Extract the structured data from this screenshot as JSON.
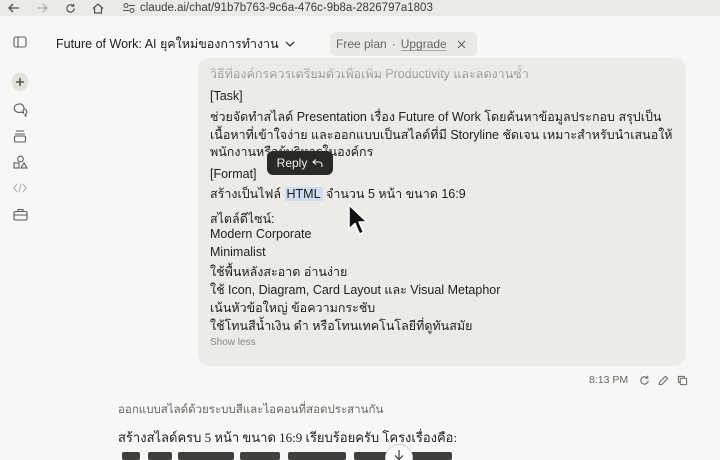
{
  "browser": {
    "url": "claude.ai/chat/91b7b763-9c6a-476c-9b8a-2826797a1803"
  },
  "header": {
    "chat_title": "Future of Work: AI ยุคใหม่ของการทำงาน",
    "plan_label": "Free plan",
    "plan_separator": "·",
    "upgrade_label": "Upgrade"
  },
  "user_message": {
    "lines": [
      "วิธีที่องค์กรควรเตรียมตัวเพื่อเพิ่ม Productivity และลดงานซ้ำ",
      "[Task]",
      "ช่วยจัดทำสไลด์ Presentation เรื่อง Future of Work โดยค้นหาข้อมูลประกอบ สรุปเป็น",
      "เนื้อหาที่เข้าใจง่าย และออกแบบเป็นสไลด์ที่มี Storyline ชัดเจน เหมาะสำหรับนำเสนอให้",
      "พนักงานหรือผู้บริหารในองค์กร",
      "[Format]",
      "สร้างเป็นไฟล์",
      "HTML",
      "จำนวน 5 หน้า ขนาด 16:9",
      "สไตล์ดีไซน์:",
      "Modern Corporate",
      "Minimalist",
      "ใช้พื้นหลังสะอาด อ่านง่าย",
      "ใช้ Icon, Diagram, Card Layout และ Visual Metaphor",
      "เน้นหัวข้อใหญ่ ข้อความกระชับ",
      "ใช้โทนสีน้ำเงิน ดำ หรือโทนเทคโนโลยีที่ดูทันสมัย"
    ],
    "show_less": "Show less"
  },
  "reply_tooltip": {
    "label": "Reply"
  },
  "message_actions": {
    "time": "8:13 PM"
  },
  "assistant_message": {
    "status": "ออกแบบสไลด์ด้วยระบบสีและไอคอนที่สอดประสานกัน",
    "reply_text": "สร้างสไลด์ครบ 5 หน้า ขนาด 16:9 เรียบร้อยครับ โครงเรื่องคือ:"
  },
  "icons": {
    "back": "arrow-left-icon",
    "forward": "arrow-right-icon",
    "reload": "reload-icon",
    "home": "home-icon",
    "site_settings": "site-settings-icon",
    "sidebar_toggle": "sidebar-toggle-icon",
    "new_chat": "plus-icon",
    "chats": "chat-bubbles-icon",
    "projects": "stack-icon",
    "artifacts": "shapes-icon",
    "code": "code-icon",
    "toolbox": "briefcase-icon"
  },
  "colors": {
    "background": "#f8f7f5",
    "message_bubble": "#ecebe8",
    "tooltip": "#2a2926",
    "highlight": "#cfdcf1"
  }
}
